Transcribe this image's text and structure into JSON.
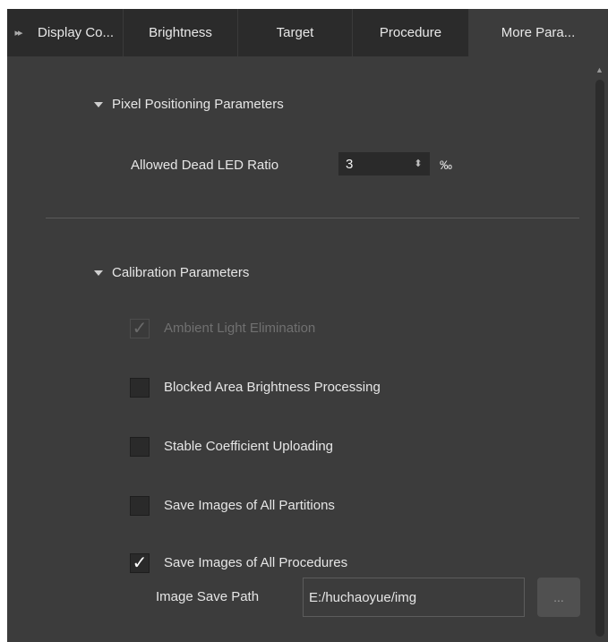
{
  "tabs": [
    {
      "label": "Display Co...",
      "active": false
    },
    {
      "label": "Brightness",
      "active": false
    },
    {
      "label": "Target",
      "active": false
    },
    {
      "label": "Procedure",
      "active": false
    },
    {
      "label": "More Para...",
      "active": true
    }
  ],
  "pixel_positioning": {
    "title": "Pixel Positioning Parameters",
    "dead_led_label": "Allowed Dead LED Ratio",
    "dead_led_value": "3",
    "dead_led_unit": "‰"
  },
  "calibration": {
    "title": "Calibration Parameters",
    "options": [
      {
        "label": "Ambient Light Elimination",
        "checked": true,
        "enabled": false
      },
      {
        "label": "Blocked Area Brightness Processing",
        "checked": false,
        "enabled": true
      },
      {
        "label": "Stable Coefficient Uploading",
        "checked": false,
        "enabled": true
      },
      {
        "label": "Save Images of All Partitions",
        "checked": false,
        "enabled": true
      },
      {
        "label": "Save Images of All Procedures",
        "checked": true,
        "enabled": true
      }
    ]
  },
  "image_save": {
    "label": "Image Save Path",
    "path": "E:/huchaoyue/img",
    "browse_label": "..."
  },
  "colors": {
    "background": "#3c3c3c",
    "tab_bar": "#2b2b2b",
    "input": "#2a2a2a",
    "text": "#e6e6e6"
  }
}
